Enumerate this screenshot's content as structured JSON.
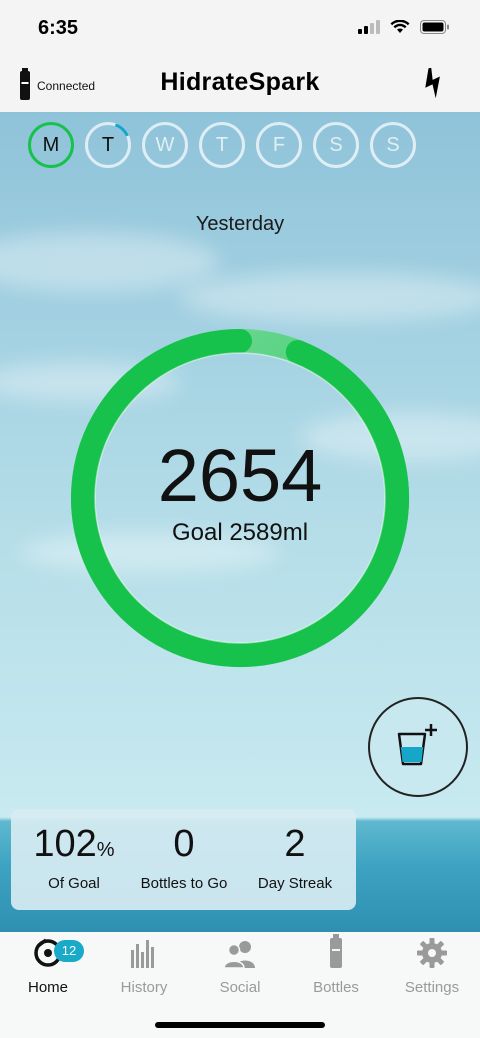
{
  "status_bar": {
    "time": "6:35"
  },
  "header": {
    "connection_status": "Connected",
    "title": "HidrateSpark",
    "flash_icon": "lightning-icon"
  },
  "week": {
    "days": [
      {
        "label": "M",
        "state": "selected"
      },
      {
        "label": "T",
        "state": "in-progress"
      },
      {
        "label": "W",
        "state": "future"
      },
      {
        "label": "T",
        "state": "future"
      },
      {
        "label": "F",
        "state": "future"
      },
      {
        "label": "S",
        "state": "future"
      },
      {
        "label": "S",
        "state": "future"
      }
    ]
  },
  "day_view": {
    "date_label": "Yesterday",
    "intake": "2654",
    "goal_text": "Goal 2589ml",
    "progress_fraction": 1.02
  },
  "stats": {
    "goal_percent": {
      "value": "102",
      "unit": "%",
      "label": "Of Goal"
    },
    "bottles": {
      "value": "0",
      "label": "Bottles to Go"
    },
    "streak": {
      "value": "2",
      "label": "Day Streak"
    }
  },
  "tabs": [
    {
      "label": "Home",
      "icon": "bottle-drop-icon",
      "badge": "12",
      "active": true
    },
    {
      "label": "History",
      "icon": "bar-chart-icon"
    },
    {
      "label": "Social",
      "icon": "people-icon"
    },
    {
      "label": "Bottles",
      "icon": "bottle-icon"
    },
    {
      "label": "Settings",
      "icon": "gear-icon"
    }
  ],
  "colors": {
    "progress_green": "#17c24c",
    "progress_light": "#6fd894",
    "badge": "#19a9c9"
  }
}
